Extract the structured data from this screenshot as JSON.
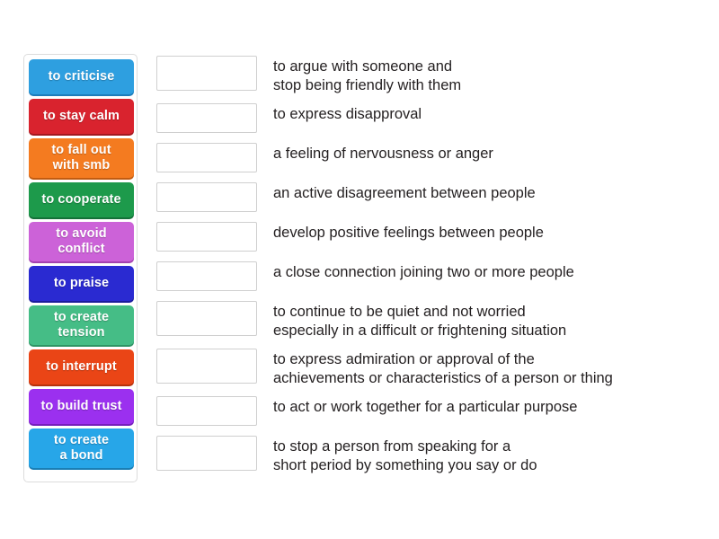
{
  "activity": {
    "type": "match-up",
    "layout": "two-column-drag-and-drop"
  },
  "tiles_panel": {
    "name": "draggable-word-tiles",
    "tiles": [
      {
        "id": "tile-to-criticise",
        "lines": [
          "to criticise"
        ],
        "bold_lines": [
          false
        ],
        "color": "#2e9fe0",
        "shadow_color": "#1d7cbb",
        "height": "h1"
      },
      {
        "id": "tile-to-stay-calm",
        "lines": [
          "to stay calm"
        ],
        "bold_lines": [
          false
        ],
        "color": "#d9232e",
        "shadow_color": "#a4171f",
        "height": "h1"
      },
      {
        "id": "tile-to-fall-out-with-smb",
        "lines": [
          "to fall out",
          "with smb"
        ],
        "bold_lines": [
          false,
          false
        ],
        "color": "#f47b20",
        "shadow_color": "#c25c11",
        "height": "h2"
      },
      {
        "id": "tile-to-cooperate",
        "lines": [
          "to cooperate"
        ],
        "bold_lines": [
          false
        ],
        "color": "#1d9a4b",
        "shadow_color": "#147038",
        "height": "h1"
      },
      {
        "id": "tile-to-avoid-conflict",
        "lines": [
          "to avoid",
          "conflict"
        ],
        "bold_lines": [
          false,
          true
        ],
        "color": "#cc62d8",
        "shadow_color": "#a441b0",
        "height": "h2"
      },
      {
        "id": "tile-to-praise",
        "lines": [
          "to praise"
        ],
        "bold_lines": [
          false
        ],
        "color": "#2a2ad1",
        "shadow_color": "#1c1c9c",
        "height": "h1"
      },
      {
        "id": "tile-to-create-tension",
        "lines": [
          "to create",
          "tension"
        ],
        "bold_lines": [
          false,
          true
        ],
        "color": "#45bd86",
        "shadow_color": "#2f9465",
        "height": "h2"
      },
      {
        "id": "tile-to-interrupt",
        "lines": [
          "to interrupt"
        ],
        "bold_lines": [
          false
        ],
        "color": "#ea4516",
        "shadow_color": "#b5310c",
        "height": "h1"
      },
      {
        "id": "tile-to-build-trust",
        "lines": [
          "to build trust"
        ],
        "bold_lines": [
          false
        ],
        "color": "#9b30ef",
        "shadow_color": "#7520bb",
        "height": "h1"
      },
      {
        "id": "tile-to-create-a-bond",
        "lines": [
          "to create",
          "a bond"
        ],
        "bold_lines": [
          false,
          true
        ],
        "color": "#27a6e8",
        "shadow_color": "#1a7fb5",
        "height": "h2"
      }
    ]
  },
  "rows": [
    {
      "id": "row-1",
      "dropzone_value": "",
      "dropzone_placeholder": "",
      "definition_lines": [
        "to argue with someone and",
        "stop being friendly with them"
      ]
    },
    {
      "id": "row-2",
      "dropzone_value": "",
      "dropzone_placeholder": "",
      "definition_lines": [
        "to express disapproval"
      ]
    },
    {
      "id": "row-3",
      "dropzone_value": "",
      "dropzone_placeholder": "",
      "definition_lines": [
        "a feeling of nervousness or anger"
      ]
    },
    {
      "id": "row-4",
      "dropzone_value": "",
      "dropzone_placeholder": "",
      "definition_lines": [
        "an active disagreement between people"
      ]
    },
    {
      "id": "row-5",
      "dropzone_value": "",
      "dropzone_placeholder": "",
      "definition_lines": [
        "develop positive feelings between people"
      ]
    },
    {
      "id": "row-6",
      "dropzone_value": "",
      "dropzone_placeholder": "",
      "definition_lines": [
        "a close connection joining two or more people"
      ]
    },
    {
      "id": "row-7",
      "dropzone_value": "",
      "dropzone_placeholder": "",
      "definition_lines": [
        "to continue to be quiet and not worried",
        "especially in a difficult or frightening situation"
      ]
    },
    {
      "id": "row-8",
      "dropzone_value": "",
      "dropzone_placeholder": "",
      "definition_lines": [
        "to express admiration or approval of the",
        "achievements or characteristics of a person or thing"
      ]
    },
    {
      "id": "row-9",
      "dropzone_value": "",
      "dropzone_placeholder": "",
      "definition_lines": [
        "to act or work together for a particular purpose"
      ]
    },
    {
      "id": "row-10",
      "dropzone_value": "",
      "dropzone_placeholder": "",
      "definition_lines": [
        "to stop a person from speaking for a",
        "short period by something you say or do"
      ]
    }
  ],
  "colors": {
    "page_background": "#ffffff",
    "panel_border": "#dcdcdc",
    "dropzone_border": "#cfcfcf",
    "definition_text": "#231f20",
    "tile_text": "#ffffff"
  }
}
